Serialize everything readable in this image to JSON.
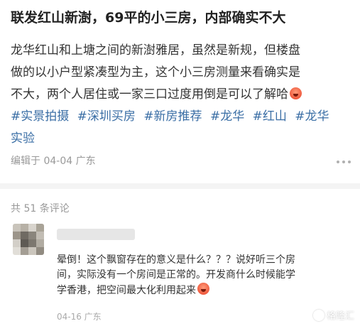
{
  "post": {
    "title": "联发红山新澍，69平的小三房，内部确实不大",
    "body_lines": [
      "龙华红山和上塘之间的新澍雅居，虽然是新规，但楼盘",
      "做的以小户型紧凑型为主，这个小三房测量来看确实是",
      "不大，两个人居住或一家三口过度用倒是可以了解哈"
    ],
    "emoji_icon": "grinning-face-emoji",
    "tags": [
      "#实景拍摄",
      "#深圳买房",
      "#新房推荐",
      "#龙华",
      "#红山",
      "#龙华"
    ],
    "tags_line2": "实验",
    "meta": "编辑于 04-04 广东",
    "more_icon": "more-dots-icon"
  },
  "comments": {
    "count_label": "共 51 条评论",
    "items": [
      {
        "avatar_icon": "blurred-avatar",
        "text_lines": [
          "晕倒！这个飘窗存在的意义是什么？？？说好听三个房",
          "间，实际没有一个房间是正常的。开发商什么时候能学",
          "学香港，把空间最大化利用起来"
        ],
        "emoji_icon": "dizzy-face-emoji",
        "meta": "04-16 广东"
      }
    ]
  },
  "watermark": {
    "text": "格隆汇",
    "logo_icon": "gelonghui-logo-icon"
  },
  "colors": {
    "tag": "#3a6ea5",
    "text": "#333333",
    "muted": "#999999",
    "divider": "#f4f4f4"
  }
}
